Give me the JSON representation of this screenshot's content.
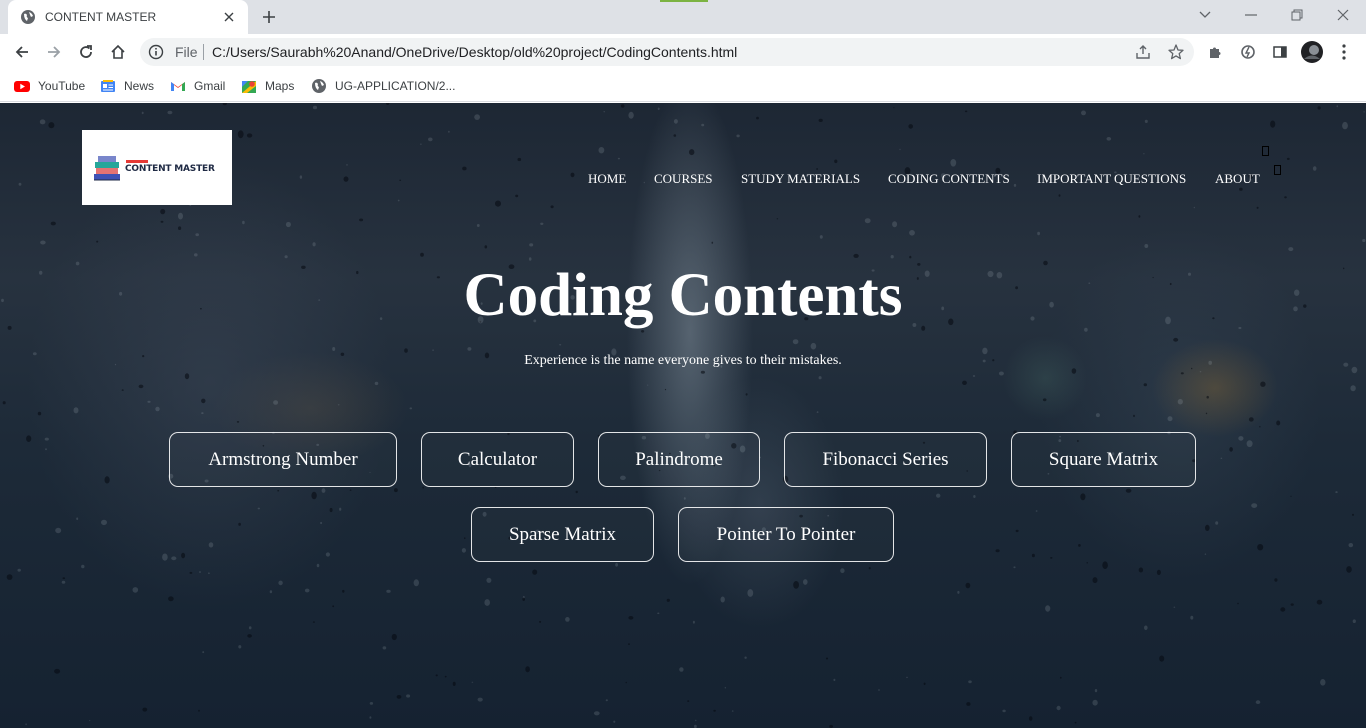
{
  "browser": {
    "tab_title": "CONTENT MASTER",
    "address_scheme": "File",
    "address_url": "C:/Users/Saurabh%20Anand/OneDrive/Desktop/old%20project/CodingContents.html",
    "bookmarks": [
      {
        "label": "YouTube",
        "icon": "youtube-icon"
      },
      {
        "label": "News",
        "icon": "news-icon"
      },
      {
        "label": "Gmail",
        "icon": "gmail-icon"
      },
      {
        "label": "Maps",
        "icon": "maps-icon"
      },
      {
        "label": "UG-APPLICATION/2...",
        "icon": "globe-icon"
      }
    ]
  },
  "site": {
    "logo_text": "CONTENT MASTER",
    "nav": [
      "HOME",
      "COURSES",
      "STUDY MATERIALS",
      "CODING CONTENTS",
      "IMPORTANT QUESTIONS",
      "ABOUT"
    ],
    "hero_title": "Coding Contents",
    "hero_subtitle": "Experience is the name everyone gives to their mistakes.",
    "buttons": [
      "Armstrong Number",
      "Calculator",
      "Palindrome",
      "Fibonacci Series",
      "Square Matrix",
      "Sparse Matrix",
      "Pointer To Pointer"
    ]
  },
  "colors": {
    "background_dark": "#1d2734",
    "text": "#ffffff",
    "button_border": "#ffffff",
    "logo_accent": "#e53935"
  }
}
